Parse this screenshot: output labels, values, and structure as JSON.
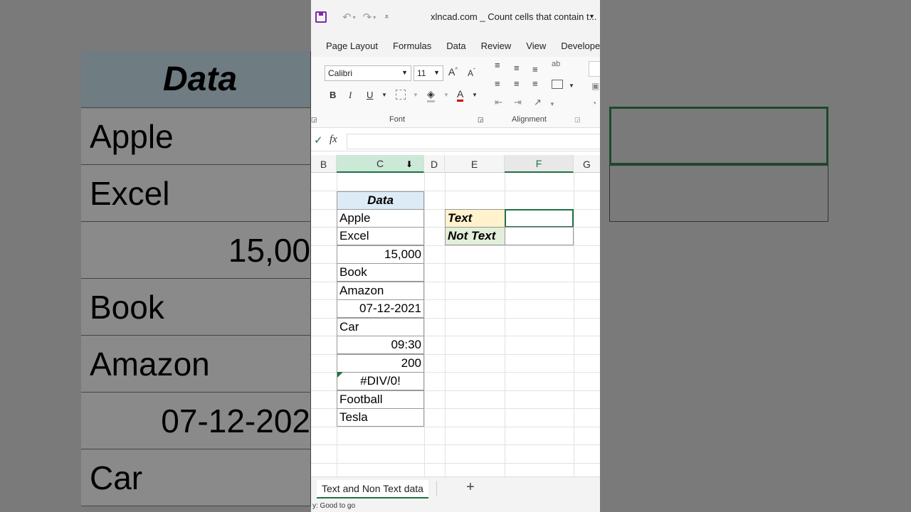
{
  "background": {
    "header": "Data",
    "rows": [
      "Apple",
      "Excel",
      "15,00",
      "Book",
      "Amazon",
      "07-12-202",
      "Car"
    ]
  },
  "titlebar": {
    "doc_title": "xlncad.com _ Count cells that contain t..."
  },
  "ribbon_tabs": [
    "Page Layout",
    "Formulas",
    "Data",
    "Review",
    "View",
    "Developer"
  ],
  "ribbon": {
    "font_name": "Calibri",
    "font_size": "11",
    "font_group_label": "Font",
    "alignment_group_label": "Alignment",
    "bold": "B",
    "italic": "I",
    "underline": "U",
    "font_color": "A"
  },
  "formula_bar": {
    "fx": "fx",
    "value": ""
  },
  "columns": [
    "B",
    "C",
    "D",
    "E",
    "F",
    "G"
  ],
  "data_table": {
    "header": "Data",
    "rows": [
      {
        "value": "Apple",
        "align": "left"
      },
      {
        "value": "Excel",
        "align": "left"
      },
      {
        "value": "15,000",
        "align": "right"
      },
      {
        "value": "Book",
        "align": "left"
      },
      {
        "value": "Amazon",
        "align": "left"
      },
      {
        "value": "07-12-2021",
        "align": "right"
      },
      {
        "value": "Car",
        "align": "left"
      },
      {
        "value": "09:30",
        "align": "right"
      },
      {
        "value": "200",
        "align": "right"
      },
      {
        "value": "#DIV/0!",
        "align": "center"
      },
      {
        "value": "Football",
        "align": "left"
      },
      {
        "value": "Tesla",
        "align": "left"
      }
    ]
  },
  "summary": {
    "text_label": "Text",
    "not_text_label": "Not Text",
    "text_value": "",
    "not_text_value": ""
  },
  "sheet_tab": "Text and Non Text data",
  "add_sheet": "+",
  "status": "y: Good to go",
  "colors": {
    "accent": "#1e7145",
    "header_fill": "#ddebf7",
    "text_fill": "#fff2cc",
    "not_text_fill": "#e2efda"
  }
}
